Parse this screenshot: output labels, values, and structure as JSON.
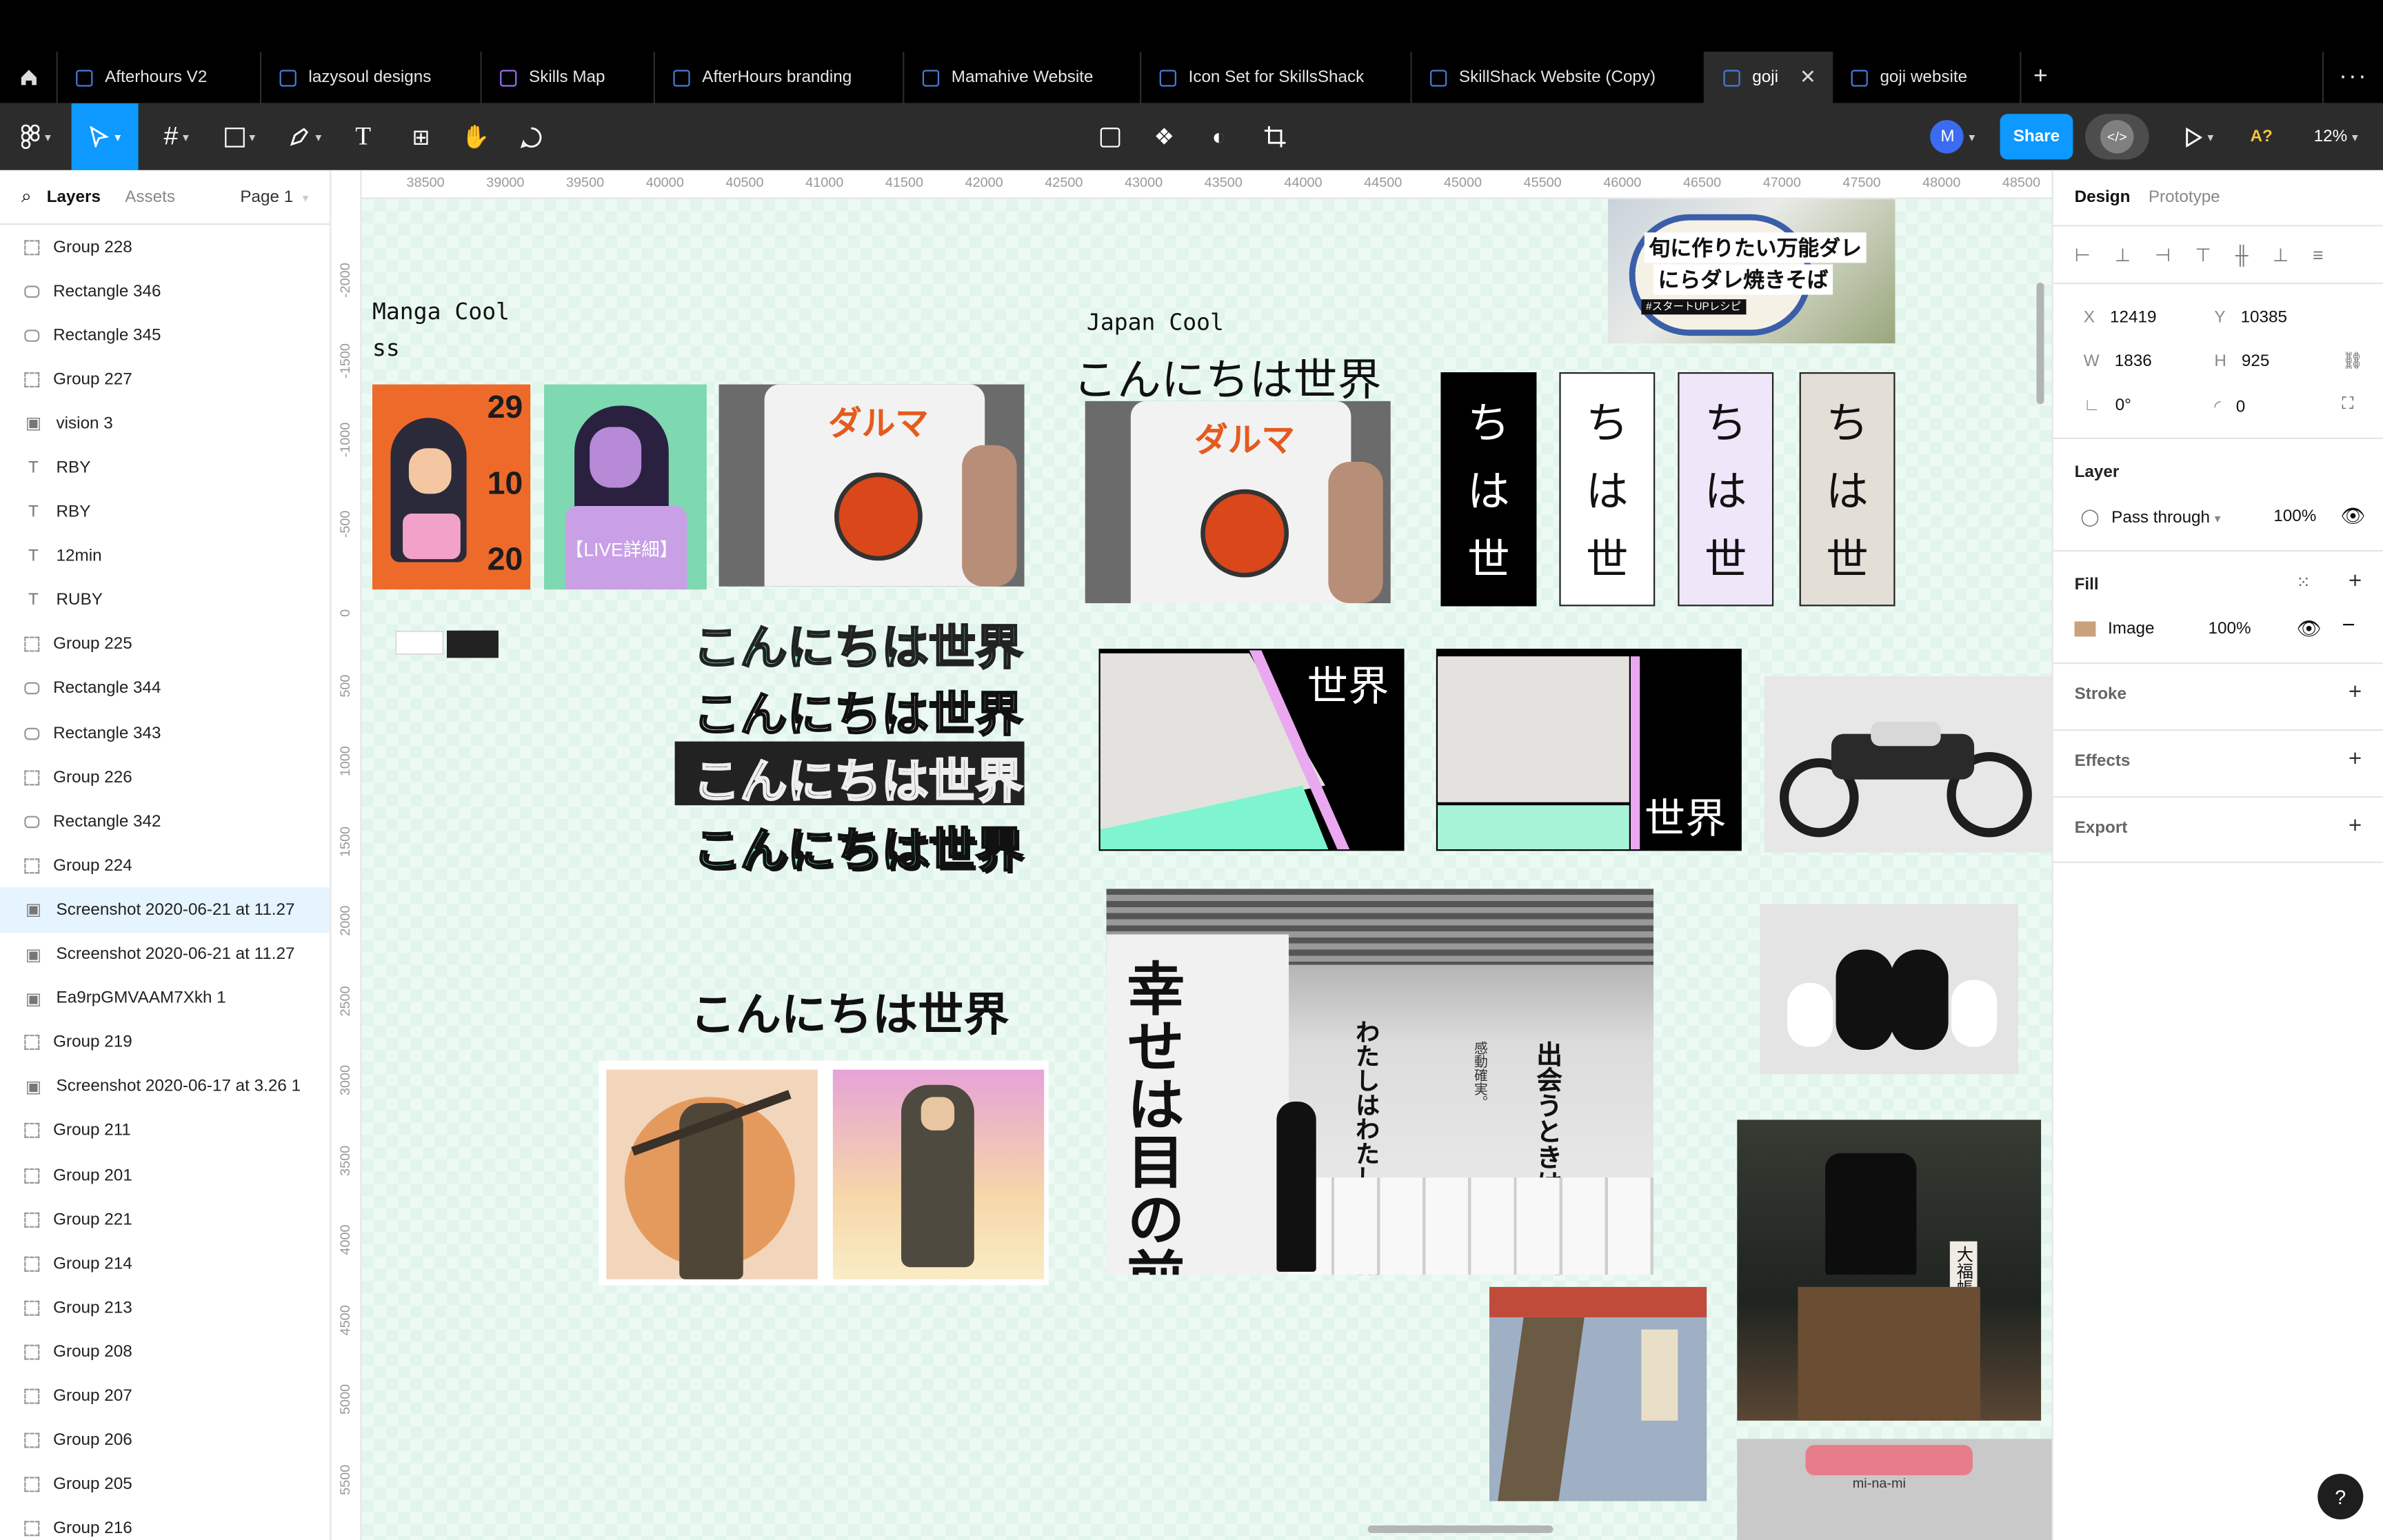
{
  "tabs": [
    {
      "label": "Afterhours V2"
    },
    {
      "label": "lazysoul designs"
    },
    {
      "label": "Skills Map"
    },
    {
      "label": "AfterHours branding"
    },
    {
      "label": "Mamahive Website"
    },
    {
      "label": "Icon Set for SkillsShack"
    },
    {
      "label": "SkillShack Website (Copy)"
    },
    {
      "label": "goji"
    },
    {
      "label": "goji website"
    }
  ],
  "toolbar": {
    "share_label": "Share",
    "avatar_initial": "M",
    "zoom": "12%",
    "ai_label": "A?"
  },
  "layers_panel": {
    "tab_layers": "Layers",
    "tab_assets": "Assets",
    "page": "Page 1",
    "items": [
      {
        "name": "Group 228",
        "kind": "group"
      },
      {
        "name": "Rectangle 346",
        "kind": "rect"
      },
      {
        "name": "Rectangle 345",
        "kind": "rect"
      },
      {
        "name": "Group 227",
        "kind": "group"
      },
      {
        "name": "vision 3",
        "kind": "image"
      },
      {
        "name": "RBY",
        "kind": "text"
      },
      {
        "name": "RBY",
        "kind": "text"
      },
      {
        "name": "12min",
        "kind": "text"
      },
      {
        "name": "RUBY",
        "kind": "text"
      },
      {
        "name": "Group 225",
        "kind": "group"
      },
      {
        "name": "Rectangle 344",
        "kind": "rect"
      },
      {
        "name": "Rectangle 343",
        "kind": "rect"
      },
      {
        "name": "Group 226",
        "kind": "group"
      },
      {
        "name": "Rectangle 342",
        "kind": "rect"
      },
      {
        "name": "Group 224",
        "kind": "group"
      },
      {
        "name": "Screenshot 2020-06-21 at 11.27",
        "kind": "image",
        "selected": true
      },
      {
        "name": "Screenshot 2020-06-21 at 11.27",
        "kind": "image"
      },
      {
        "name": "Ea9rpGMVAAM7Xkh 1",
        "kind": "image"
      },
      {
        "name": "Group 219",
        "kind": "group"
      },
      {
        "name": "Screenshot 2020-06-17 at 3.26 1",
        "kind": "image"
      },
      {
        "name": "Group 211",
        "kind": "group"
      },
      {
        "name": "Group 201",
        "kind": "group"
      },
      {
        "name": "Group 221",
        "kind": "group"
      },
      {
        "name": "Group 214",
        "kind": "group"
      },
      {
        "name": "Group 213",
        "kind": "group"
      },
      {
        "name": "Group 208",
        "kind": "group"
      },
      {
        "name": "Group 207",
        "kind": "group"
      },
      {
        "name": "Group 206",
        "kind": "group"
      },
      {
        "name": "Group 205",
        "kind": "group"
      },
      {
        "name": "Group 216",
        "kind": "group"
      }
    ]
  },
  "ruler": {
    "top": [
      "38500",
      "39000",
      "39500",
      "40000",
      "40500",
      "41000",
      "41500",
      "42000",
      "42500",
      "43000",
      "43500",
      "44000",
      "44500",
      "45000",
      "45500",
      "46000",
      "46500",
      "47000",
      "47500",
      "48000",
      "48500"
    ],
    "left": [
      "-2000",
      "-1500",
      "-1000",
      "-500",
      "0",
      "500",
      "1000",
      "1500",
      "2000",
      "2500",
      "3000",
      "3500",
      "4000",
      "4500",
      "5000",
      "5500"
    ]
  },
  "canvas": {
    "manga_title_line1": "Manga Cool",
    "manga_title_line2": "ss",
    "japan_title": "Japan Cool",
    "hello_world": "こんにちは世界",
    "sekai": "世界",
    "vertical_chars": [
      "ち",
      "は",
      "世"
    ],
    "poster_numbers": [
      "29",
      "10",
      "20"
    ],
    "poster_live": "【LIVE詳細】",
    "daruma": "ダルマ",
    "food_line1": "旬に作りたい万能ダレ",
    "food_line2": "にらダレ焼きそば",
    "food_tag": "#スタートUPレシピ",
    "gallery_big": "目の前。",
    "gallery_big2": "幸せは",
    "gallery_mid1": "わたしはわたしの道をゆく。",
    "gallery_mid2": "出会うときは出会う。",
    "gallery_small": "感動確実。",
    "shop_sign": "大福帳",
    "bottom_sign": "mi-na-mi"
  },
  "design_panel": {
    "tab_design": "Design",
    "tab_prototype": "Prototype",
    "x_label": "X",
    "x": "12419",
    "y_label": "Y",
    "y": "10385",
    "w_label": "W",
    "w": "1836",
    "h_label": "H",
    "h": "925",
    "rotation": "0°",
    "radius": "0",
    "layer_title": "Layer",
    "blend": "Pass through",
    "layer_opacity": "100%",
    "fill_title": "Fill",
    "fill_type": "Image",
    "fill_opacity": "100%",
    "stroke_title": "Stroke",
    "effects_title": "Effects",
    "export_title": "Export"
  },
  "help_label": "?",
  "colors": {
    "accent": "#0d99ff",
    "mint": "#7ef5cf",
    "pink": "#e9a8ef",
    "canvas_bg": "#ecfaf3",
    "toolbar_bg": "#2c2c2c"
  }
}
